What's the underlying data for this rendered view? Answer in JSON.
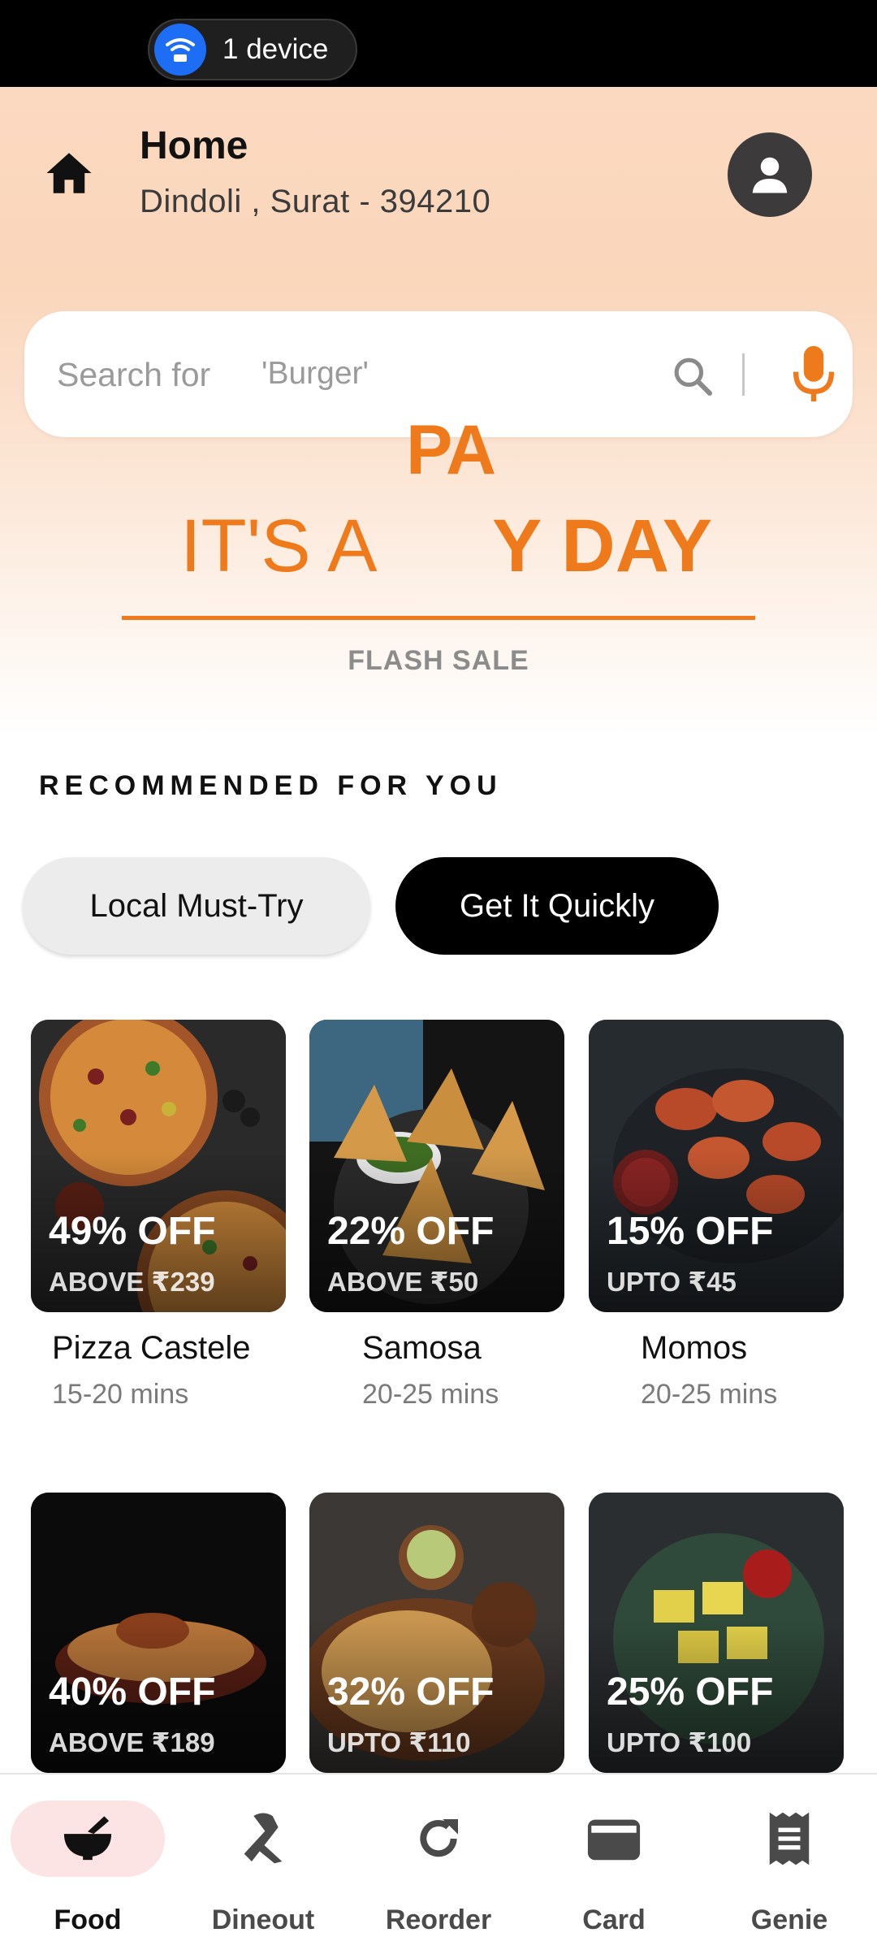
{
  "status_bar": {
    "device_label": "1 device"
  },
  "location": {
    "title": "Home",
    "address": "Dindoli , Surat  -  394210"
  },
  "search": {
    "placeholder_prefix": "Search for",
    "placeholder_example": "'Burger'"
  },
  "banner": {
    "word_top": "PA",
    "word_left": "IT'S A",
    "word_right": "Y DAY",
    "subtitle": "FLASH SALE"
  },
  "section": {
    "title": "RECOMMENDED FOR YOU"
  },
  "chips": [
    {
      "label": "Local Must-Try",
      "selected": false
    },
    {
      "label": "Get It Quickly",
      "selected": true
    }
  ],
  "items": [
    {
      "offer": "49% OFF",
      "condition": "ABOVE ₹239",
      "name": "Pizza Castele",
      "time": "15-20 mins"
    },
    {
      "offer": "22% OFF",
      "condition": "ABOVE ₹50",
      "name": "Samosa",
      "time": "20-25 mins"
    },
    {
      "offer": "15% OFF",
      "condition": "UPTO ₹45",
      "name": "Momos",
      "time": "20-25 mins"
    },
    {
      "offer": "40% OFF",
      "condition": "ABOVE ₹189"
    },
    {
      "offer": "32% OFF",
      "condition": "UPTO ₹110"
    },
    {
      "offer": "25% OFF",
      "condition": "UPTO ₹100"
    }
  ],
  "bottom_nav": [
    {
      "label": "Food",
      "icon": "mortar-bowl-icon",
      "active": true
    },
    {
      "label": "Dineout",
      "icon": "ribbon-icon",
      "active": false
    },
    {
      "label": "Reorder",
      "icon": "refresh-icon",
      "active": false
    },
    {
      "label": "Card",
      "icon": "wallet-icon",
      "active": false
    },
    {
      "label": "Genie",
      "icon": "receipt-icon",
      "active": false
    }
  ],
  "colors": {
    "accent": "#ef7a1b",
    "mic": "#ef7a1b",
    "active_nav_bg": "#fde4e4",
    "avatar_bg": "#3c3a3b"
  }
}
